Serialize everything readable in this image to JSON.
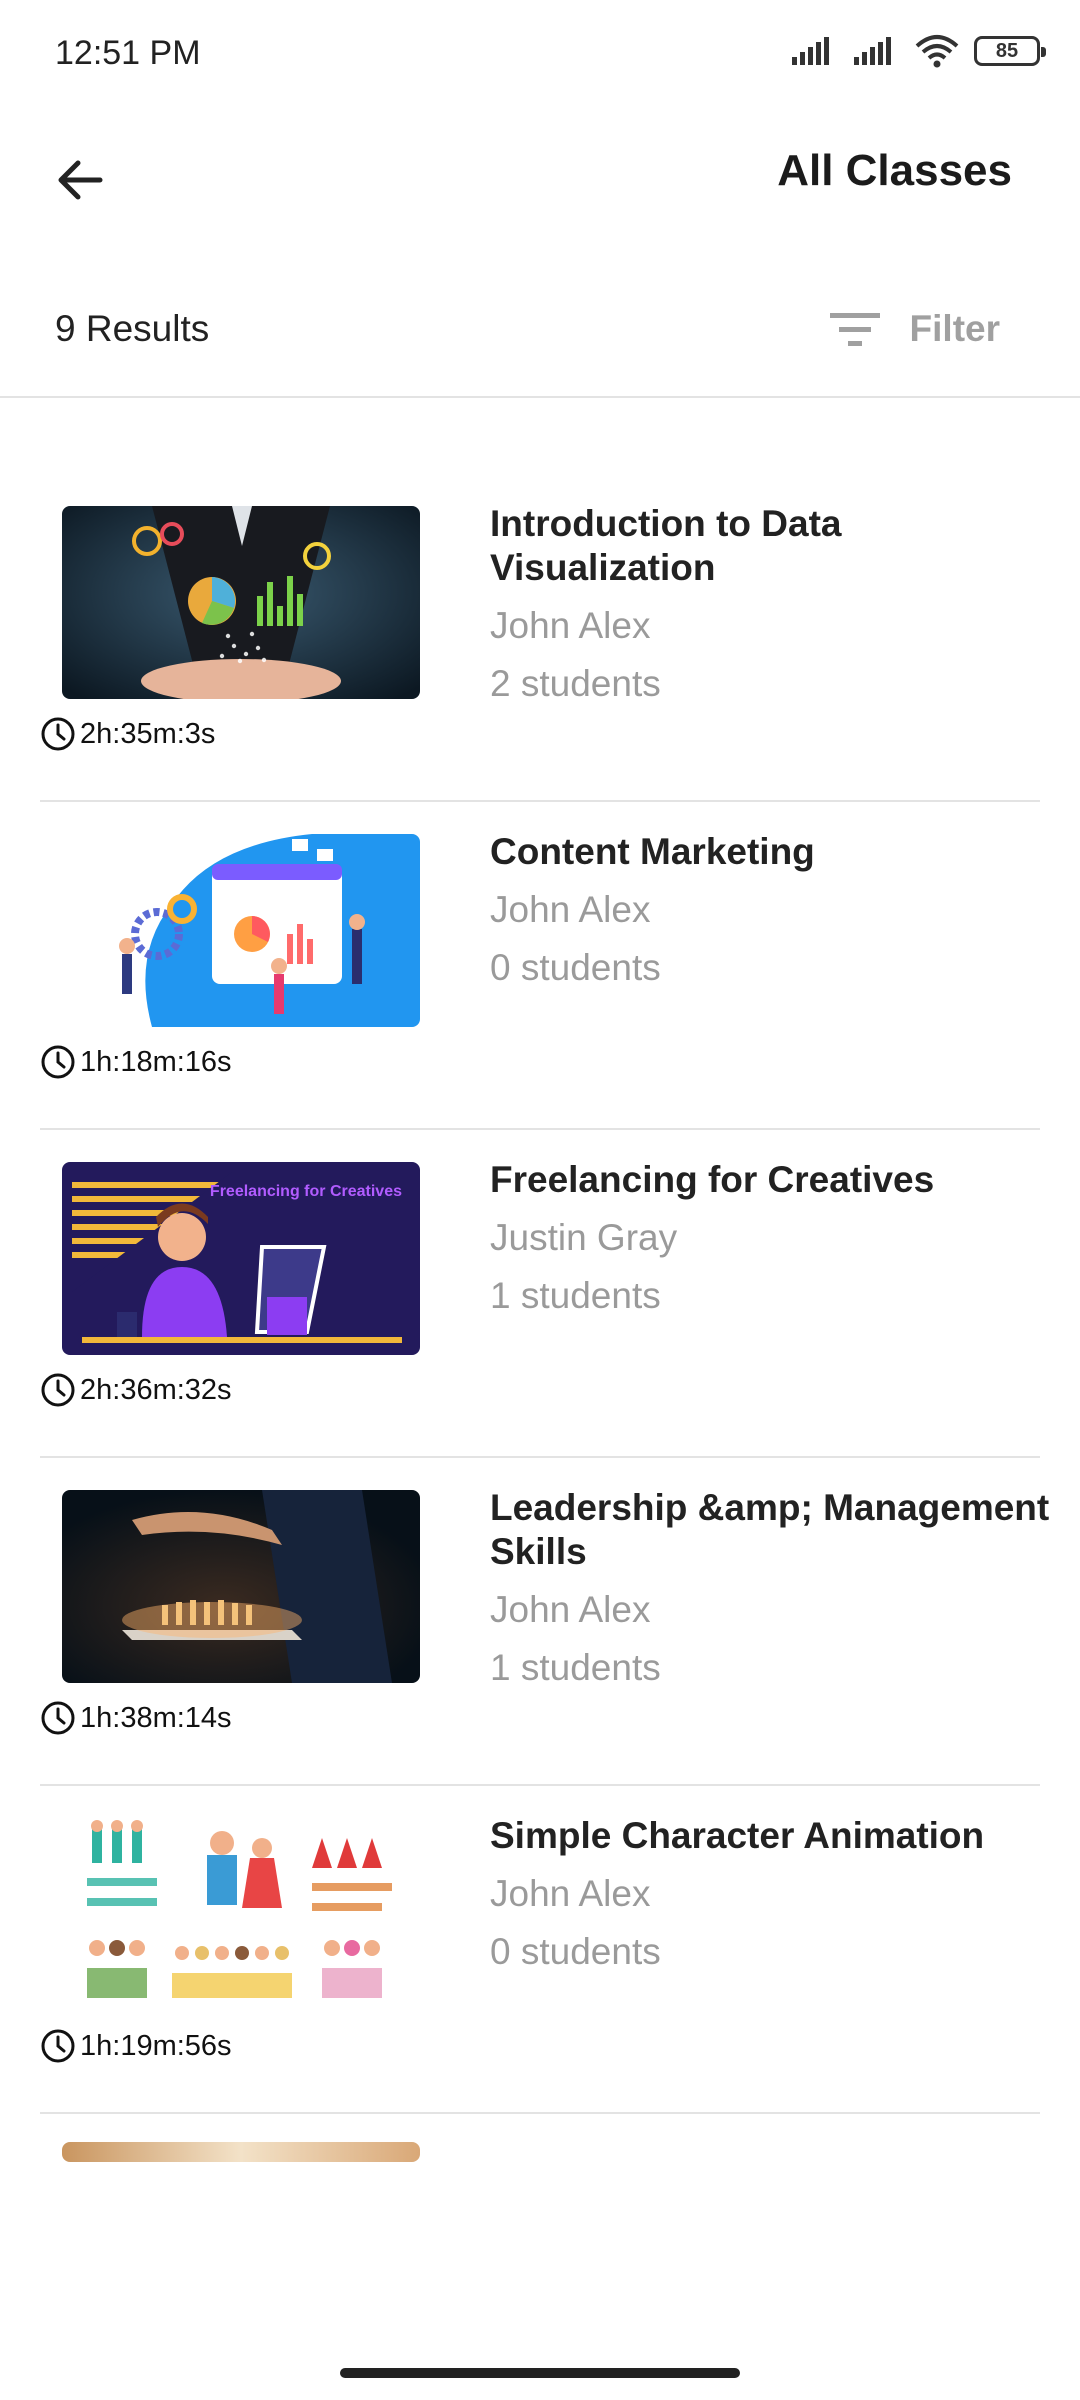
{
  "status": {
    "time": "12:51 PM",
    "battery": "85"
  },
  "header": {
    "title": "All Classes"
  },
  "results": {
    "count_label": "9 Results",
    "filter_label": "Filter"
  },
  "classes": [
    {
      "title": "Introduction to Data Visualization",
      "author": "John Alex",
      "students": "2 students",
      "duration": "2h:35m:3s"
    },
    {
      "title": "Content Marketing",
      "author": "John Alex",
      "students": "0 students",
      "duration": "1h:18m:16s"
    },
    {
      "title": "Freelancing for Creatives",
      "author": "Justin Gray",
      "students": "1 students",
      "duration": "2h:36m:32s",
      "thumb_text": "Freelancing for Creatives"
    },
    {
      "title": "Leadership &amp; Management Skills",
      "author": "John Alex",
      "students": "1 students",
      "duration": "1h:38m:14s"
    },
    {
      "title": "Simple Character Animation",
      "author": "John Alex",
      "students": "0 students",
      "duration": "1h:19m:56s"
    }
  ]
}
